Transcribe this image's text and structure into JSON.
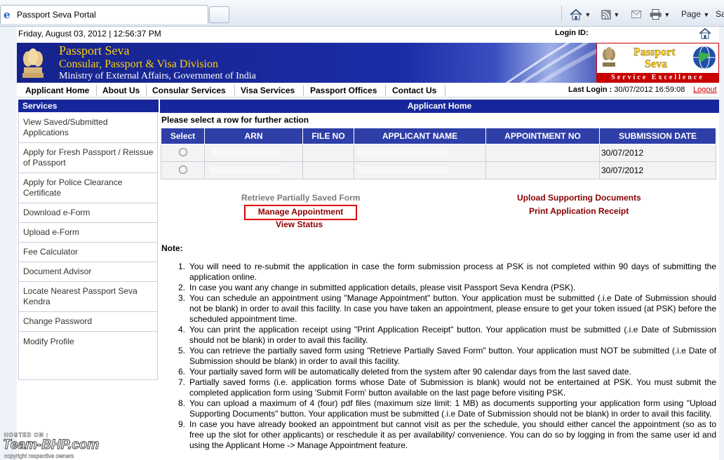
{
  "browser": {
    "tab_title": "Passport Seva Portal",
    "toolbar": {
      "page_label": "Page",
      "safety_label_partial": "Sa"
    }
  },
  "header": {
    "date_time": "Friday,  August  03, 2012 | 12:56:37 PM",
    "login_id_label": "Login ID:"
  },
  "banner": {
    "title": "Passport Seva",
    "subtitle1": "Consular, Passport & Visa Division",
    "subtitle2": "Ministry of External Affairs, Government of India",
    "logo_line1": "Passport",
    "logo_line2": "Seva",
    "logo_tagline": "Service Excellence"
  },
  "nav": {
    "items": [
      "Applicant Home",
      "About Us",
      "Consular Services",
      "Visa Services",
      "Passport Offices",
      "Contact Us"
    ],
    "last_login_label": "Last Login :",
    "last_login_value": " 30/07/2012 16:59:08",
    "logout": "Logout"
  },
  "sidebar": {
    "heading": "Services",
    "items": [
      "View Saved/Submitted Applications",
      "Apply for Fresh Passport / Reissue of Passport",
      "Apply for Police Clearance Certificate",
      "Download e-Form",
      "Upload e-Form",
      "Fee Calculator",
      "Document Advisor",
      "Locate Nearest Passport Seva Kendra",
      "Change Password",
      "Modify Profile"
    ]
  },
  "main": {
    "heading": "Applicant Home",
    "instruction": "Please select a row for further action",
    "table": {
      "columns": [
        "Select",
        "ARN",
        "FILE NO",
        "APPLICANT NAME",
        "APPOINTMENT NO",
        "SUBMISSION DATE"
      ],
      "rows": [
        {
          "submission_date": "30/07/2012"
        },
        {
          "submission_date": "30/07/2012"
        }
      ]
    },
    "actions": {
      "retrieve": "Retrieve Partially Saved Form",
      "manage": "Manage Appointment",
      "status": "View Status",
      "upload": "Upload Supporting Documents",
      "print": "Print Application Receipt"
    },
    "note_label": "Note:",
    "notes": [
      "You will need to re-submit the application in case the form submission process at PSK is not completed within 90 days of submitting the application online.",
      "In case you want any change in submitted application details, please visit Passport Seva Kendra (PSK).",
      "You can schedule an appointment using \"Manage Appointment\" button. Your application must be submitted (.i.e Date of Submission should not be blank) in order to avail this facility. In case you have taken an appointment, please ensure to get your token issued (at PSK) before the scheduled appointment time.",
      "You can print the application receipt using \"Print Application Receipt\" button. Your application must be submitted (.i.e Date of Submission should not be blank) in order to avail this facility.",
      "You can retrieve the partially saved form using \"Retrieve Partially Saved Form\" button. Your application must NOT be submitted (.i.e Date of Submission should be blank) in order to avail this facility.",
      "Your partially saved form will be automatically deleted from the system after 90 calendar days from the last saved date.",
      "Partially saved forms (i.e. application forms whose Date of Submission is blank) would not be entertained at PSK. You must submit the completed application form using 'Submit Form' button available on the last page before visiting PSK.",
      "You can upload a maximum of 4 (four) pdf files (maximum size limit: 1 MB) as documents supporting your application form using \"Upload Supporting Documents\" button. Your application must be submitted (.i.e Date of Submission should not be blank) in order to avail this facility.",
      "In case you have already booked an appointment but cannot visit as per the schedule, you should either cancel the appointment (so as to free up the slot for other applicants) or reschedule it as per availability/ convenience. You can do so by logging in from the same user id and using the Applicant Home -> Manage Appointment feature."
    ]
  },
  "watermark": {
    "hosted_on": "HOSTED ON :",
    "brand": "Team-BHP.com",
    "copyright": "copyright respective owners"
  },
  "colors": {
    "nav_blue": "#17279b",
    "header_blue": "#2f3fa8",
    "action_red": "#8b0000",
    "highlight_red": "#e00000",
    "gold": "#ffd100"
  }
}
